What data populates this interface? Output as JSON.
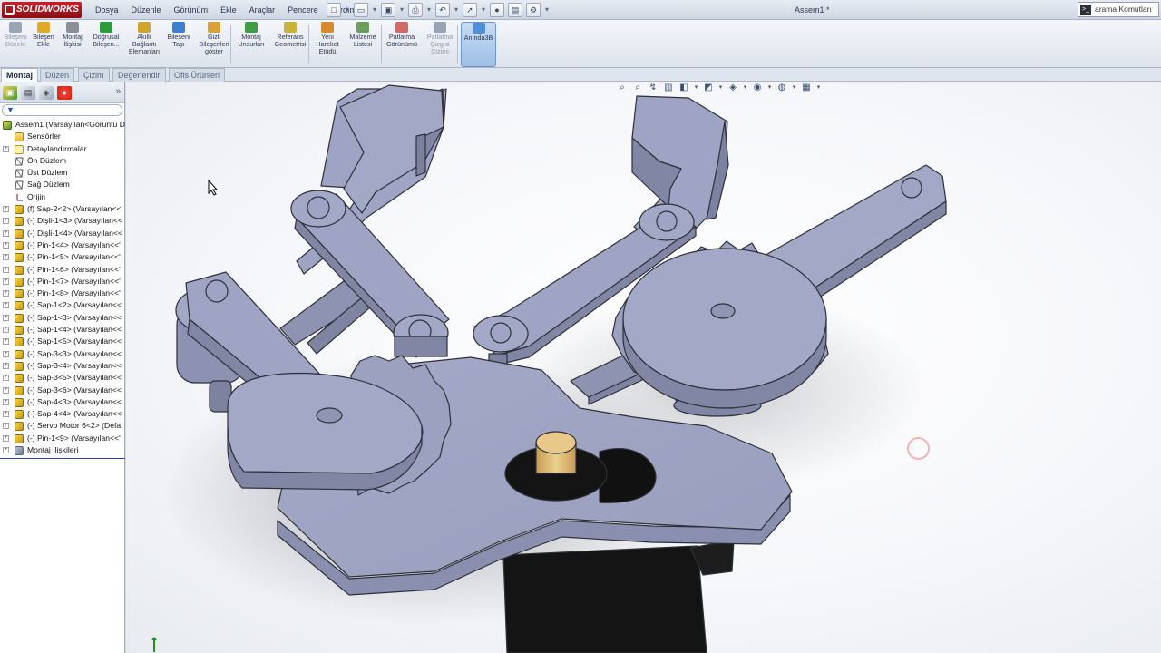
{
  "app": {
    "brand": "SOLIDWORKS",
    "document_title": "Assem1 *"
  },
  "menu": [
    "Dosya",
    "Düzenle",
    "Görünüm",
    "Ekle",
    "Araçlar",
    "Pencere",
    "Yardım"
  ],
  "search": {
    "label": "arama Komutları",
    "icon": "terminal-icon"
  },
  "toolbar": [
    {
      "label": "Bileşeni Düzele",
      "icon": "edit-component-icon",
      "disabled": true
    },
    {
      "label": "Bileşen Ekle",
      "icon": "insert-component-icon"
    },
    {
      "label": "Montaj İlişkisi",
      "icon": "mate-icon"
    },
    {
      "label": "Doğrusal Bileşen...",
      "icon": "linear-pattern-icon"
    },
    {
      "label": "Akıllı Bağlantı Elemanları",
      "icon": "smart-fasteners-icon"
    },
    {
      "label": "Bileşeni Taşı",
      "icon": "move-component-icon"
    },
    {
      "label": "Gizli Bileşenleri göster",
      "icon": "show-hidden-icon"
    },
    {
      "label": "Montaj Unsurları",
      "icon": "assembly-features-icon"
    },
    {
      "label": "Referans Geometrisi",
      "icon": "reference-geometry-icon"
    },
    {
      "label": "Yeni Hareket Etüdü",
      "icon": "new-motion-study-icon"
    },
    {
      "label": "Malzeme Listesi",
      "icon": "bill-of-materials-icon"
    },
    {
      "label": "Patlatma Görünümü",
      "icon": "exploded-view-icon"
    },
    {
      "label": "Patlatma Çizgisi Çizimi",
      "icon": "explode-line-sketch-icon",
      "disabled": true
    },
    {
      "label": "Anında3B",
      "icon": "instant3d-icon",
      "active": true
    }
  ],
  "tabs": [
    "Montaj",
    "Düzen",
    "Çizim",
    "Değerlendir",
    "Ofis Ürünleri"
  ],
  "active_tab": "Montaj",
  "tree": [
    {
      "label": "Assem1  (Varsayılan<Görüntü D",
      "type": "asm",
      "indent": 0
    },
    {
      "label": "Sensörler",
      "type": "folder",
      "indent": 1
    },
    {
      "label": "Detaylandırmalar",
      "type": "note",
      "indent": 1,
      "expand": "+"
    },
    {
      "label": "Ön Düzlem",
      "type": "plane",
      "indent": 1
    },
    {
      "label": "Üst Düzlem",
      "type": "plane",
      "indent": 1
    },
    {
      "label": "Sağ Düzlem",
      "type": "plane",
      "indent": 1
    },
    {
      "label": "Orijin",
      "type": "origin",
      "indent": 1
    },
    {
      "label": "(f) Sap-2<2> (Varsayılan<<",
      "type": "part",
      "indent": 1,
      "expand": "+"
    },
    {
      "label": "(-) Dişli-1<3> (Varsayılan<<",
      "type": "part",
      "indent": 1,
      "expand": "+"
    },
    {
      "label": "(-) Dişli-1<4> (Varsayılan<<",
      "type": "part",
      "indent": 1,
      "expand": "+"
    },
    {
      "label": "(-) Pin-1<4> (Varsayılan<<'",
      "type": "part",
      "indent": 1,
      "expand": "+"
    },
    {
      "label": "(-) Pin-1<5> (Varsayılan<<'",
      "type": "part",
      "indent": 1,
      "expand": "+"
    },
    {
      "label": "(-) Pin-1<6> (Varsayılan<<'",
      "type": "part",
      "indent": 1,
      "expand": "+"
    },
    {
      "label": "(-) Pin-1<7> (Varsayılan<<'",
      "type": "part",
      "indent": 1,
      "expand": "+"
    },
    {
      "label": "(-) Pin-1<8> (Varsayılan<<'",
      "type": "part",
      "indent": 1,
      "expand": "+"
    },
    {
      "label": "(-) Sap-1<2> (Varsayılan<<",
      "type": "part",
      "indent": 1,
      "expand": "+"
    },
    {
      "label": "(-) Sap-1<3> (Varsayılan<<",
      "type": "part",
      "indent": 1,
      "expand": "+"
    },
    {
      "label": "(-) Sap-1<4> (Varsayılan<<",
      "type": "part",
      "indent": 1,
      "expand": "+"
    },
    {
      "label": "(-) Sap-1<5> (Varsayılan<<",
      "type": "part",
      "indent": 1,
      "expand": "+"
    },
    {
      "label": "(-) Sap-3<3> (Varsayılan<<",
      "type": "part",
      "indent": 1,
      "expand": "+"
    },
    {
      "label": "(-) Sap-3<4> (Varsayılan<<",
      "type": "part",
      "indent": 1,
      "expand": "+"
    },
    {
      "label": "(-) Sap-3<5> (Varsayılan<<",
      "type": "part",
      "indent": 1,
      "expand": "+"
    },
    {
      "label": "(-) Sap-3<6> (Varsayılan<<",
      "type": "part",
      "indent": 1,
      "expand": "+"
    },
    {
      "label": "(-) Sap-4<3> (Varsayılan<<",
      "type": "part",
      "indent": 1,
      "expand": "+"
    },
    {
      "label": "(-) Sap-4<4> (Varsayılan<<",
      "type": "part",
      "indent": 1,
      "expand": "+"
    },
    {
      "label": "(-) Servo Motor 6<2> (Defa",
      "type": "part",
      "indent": 1,
      "expand": "+"
    },
    {
      "label": "(-) Pin-1<9> (Varsayılan<<'",
      "type": "part",
      "indent": 1,
      "expand": "+"
    },
    {
      "label": "Montaj İlişkileri",
      "type": "mates",
      "indent": 1,
      "expand": "+"
    }
  ],
  "heads_up_toolbar": [
    "zoom-to-fit-icon",
    "zoom-area-icon",
    "previous-view-icon",
    "section-view-icon",
    "view-orientation-icon",
    "display-style-icon",
    "hide-show-icon",
    "edit-appearance-icon",
    "apply-scene-icon",
    "view-settings-icon"
  ],
  "colors": {
    "part": "#9fa4c4",
    "part_side": "#8186a5",
    "edge": "#2d3038",
    "motor": "#151515",
    "shaft": "#e3c07d"
  }
}
